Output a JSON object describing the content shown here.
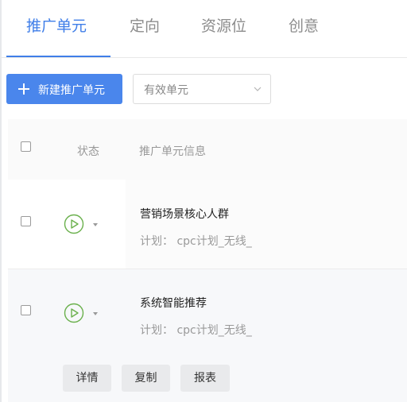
{
  "tabs": [
    {
      "label": "推广单元",
      "active": true
    },
    {
      "label": "定向",
      "active": false
    },
    {
      "label": "资源位",
      "active": false
    },
    {
      "label": "创意",
      "active": false
    }
  ],
  "toolbar": {
    "new_button_label": "新建推广单元",
    "filter_select_value": "有效单元"
  },
  "table": {
    "headers": {
      "status": "状态",
      "info": "推广单元信息"
    },
    "rows": [
      {
        "name": "营销场景核心人群",
        "plan": "计划： cpc计划_无线_"
      },
      {
        "name": "系统智能推荐",
        "plan": "计划： cpc计划_无线_"
      }
    ],
    "row_actions": [
      "详情",
      "复制",
      "报表"
    ]
  },
  "colors": {
    "accent": "#3f7ee8",
    "primary_button": "#4a86ec",
    "status_green": "#6ab04c"
  },
  "icons": {
    "new_button": "plus-icon",
    "select": "chevron-down-icon",
    "status": "play-circle-icon",
    "status_dropdown": "caret-down-icon"
  }
}
